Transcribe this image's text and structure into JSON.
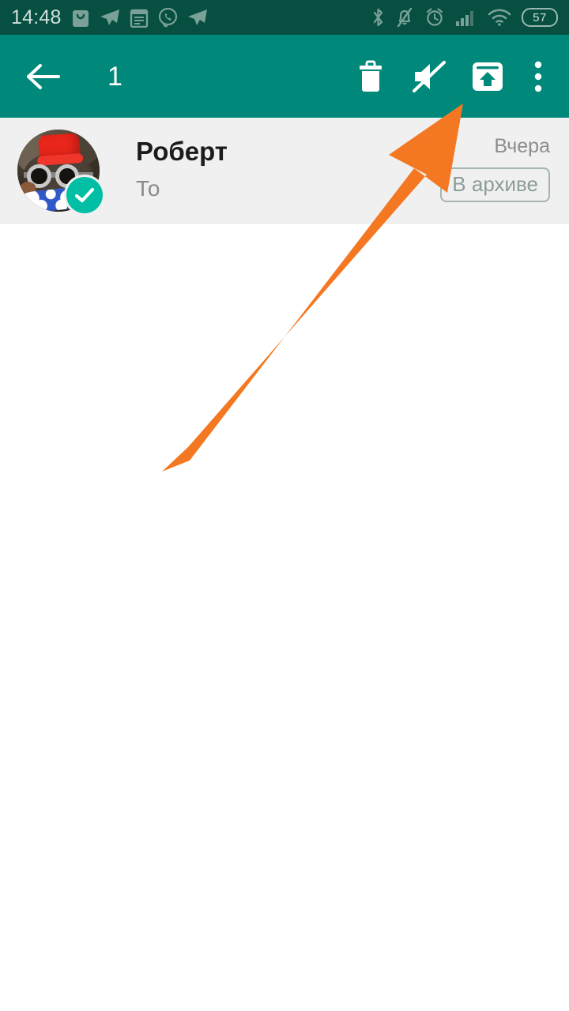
{
  "status_bar": {
    "time": "14:48",
    "battery_level": "57",
    "left_icons": [
      "shopping-bag-icon",
      "telegram-plane-icon",
      "calendar-notes-icon",
      "viber-phone-icon",
      "telegram-plane-icon-2"
    ],
    "right_icons": [
      "bluetooth-icon",
      "notifications-muted-bell-icon",
      "alarm-clock-icon",
      "cellular-signal-icon",
      "wifi-icon",
      "battery-icon"
    ],
    "background_color": "#064f41",
    "foreground_color": "#cfe0db"
  },
  "action_bar": {
    "back_label": "back-arrow",
    "selected_count": "1",
    "background_color": "#00897b",
    "actions": [
      {
        "name": "delete-button",
        "label": "Удалить"
      },
      {
        "name": "mute-button",
        "label": "Без звука"
      },
      {
        "name": "unarchive-button",
        "label": "Разархивировать"
      },
      {
        "name": "overflow-menu-button",
        "label": "Ещё"
      }
    ]
  },
  "chat_list": {
    "rows": [
      {
        "name": "Роберт",
        "preview": "То",
        "time": "Вчера",
        "badge": "В архиве",
        "selected": true,
        "avatar_alt": "Аватар: кот в красной феске и очках"
      }
    ]
  },
  "annotation": {
    "arrow_color": "#f47721",
    "points_to": "unarchive-button"
  }
}
